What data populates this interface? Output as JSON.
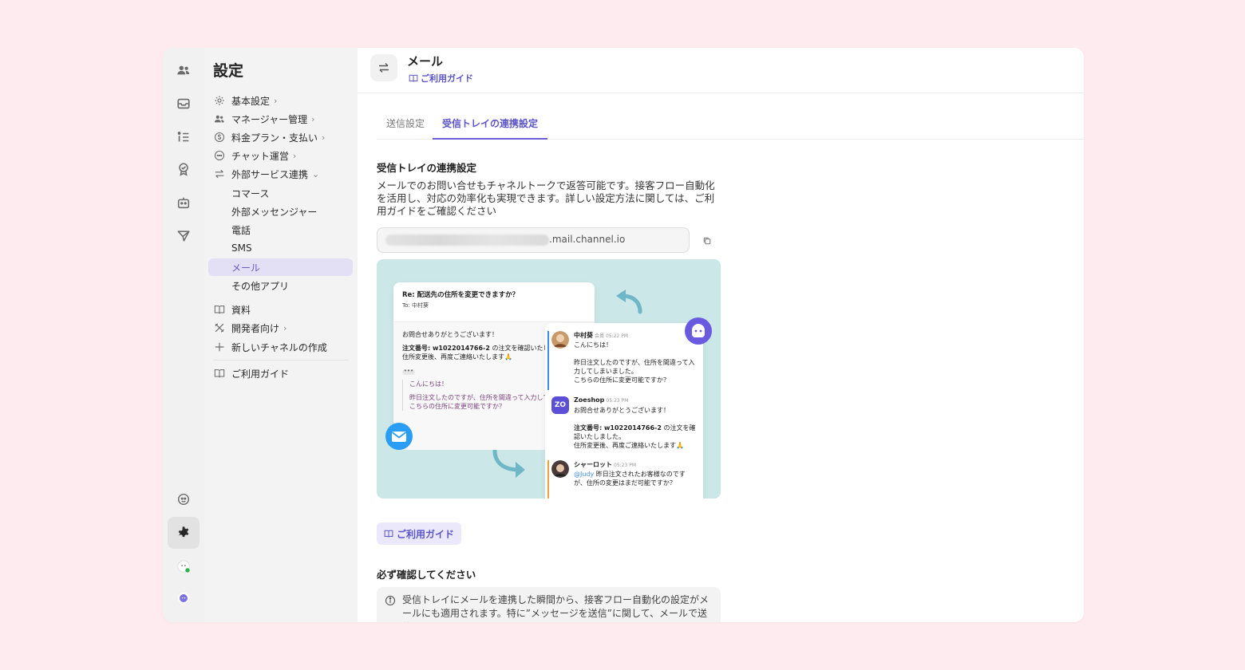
{
  "sidebar": {
    "title": "設定",
    "items": [
      {
        "label": "基本設定",
        "icon": "gear-icon",
        "chevron": "›"
      },
      {
        "label": "マネージャー管理",
        "icon": "people-icon",
        "chevron": "›"
      },
      {
        "label": "料金プラン・支払い",
        "icon": "dollar-icon",
        "chevron": "›"
      },
      {
        "label": "チャット運営",
        "icon": "chat-icon",
        "chevron": "›"
      },
      {
        "label": "外部サービス連携",
        "icon": "swap-icon",
        "chevron": "⌄"
      },
      {
        "label": "コマース"
      },
      {
        "label": "外部メッセンジャー"
      },
      {
        "label": "電話"
      },
      {
        "label": "SMS"
      },
      {
        "label": "メール"
      },
      {
        "label": "その他アプリ"
      },
      {
        "label": "資料",
        "icon": "book-icon"
      },
      {
        "label": "開発者向け",
        "icon": "tools-icon",
        "chevron": "›"
      },
      {
        "label": "新しいチャネルの作成",
        "icon": "plus-icon"
      },
      {
        "label": "ご利用ガイド",
        "icon": "book-icon"
      }
    ]
  },
  "header": {
    "title": "メール",
    "guide_link": "ご利用ガイド"
  },
  "tabs": [
    {
      "label": "送信設定"
    },
    {
      "label": "受信トレイの連携設定"
    }
  ],
  "section": {
    "title": "受信トレイの連携設定",
    "description": "メールでのお問い合せもチャネルトークで返答可能です。接客フロー自動化を活用し、対応の効率化も実現できます。詳しい設定方法に関しては、ご利用ガイドをご確認ください",
    "email_domain": ".mail.channel.io"
  },
  "illustration": {
    "mail": {
      "subject": "Re: 配送先の住所を変更できますか？",
      "to": "To: 中村葵",
      "line1": "お問合せありがとうございます！",
      "line2_bold": "注文番号: w1022014766-2",
      "line2_rest": " の注文を確認いたしました。",
      "line3": "住所変更後、再度ご連絡いたします🙏",
      "quote1": "こんにちは！",
      "quote2": "昨日注文したのですが、住所を間違って入力してしまいました。",
      "quote3": "こちらの住所に変更可能ですか？"
    },
    "chat": [
      {
        "name": "中村葵",
        "tag": "会員",
        "time": "05:22 PM",
        "text": "こんにちは！\n\n昨日注文したのですが、住所を間違って入力してしまいました。\nこちらの住所に変更可能ですか？"
      },
      {
        "name": "Zoeshop",
        "time": "05:23 PM",
        "text": "お問合せありがとうございます！",
        "bold": "注文番号: w1022014766-2",
        "rest": " の注文を確認いたしました。\n住所変更後、再度ご連絡いたします🙏"
      },
      {
        "name": "シャーロット",
        "time": "05:23 PM",
        "mention": "@Judy",
        "text": " 昨日注文されたお客様なのですが、住所の変更はまだ可能ですか？"
      }
    ],
    "zo_logo": "ZO"
  },
  "guide_button": "ご利用ガイド",
  "must_check": {
    "title": "必ず確認してください",
    "text": "受信トレイにメールを連携した瞬間から、接客フロー自動化の設定がメールにも適用されます。特に”メッセージを送信”に関して、メールで送信し"
  },
  "colors": {
    "accent": "#5b55c9",
    "background": "#fdebef",
    "illustration_bg": "#cbe7e8"
  }
}
